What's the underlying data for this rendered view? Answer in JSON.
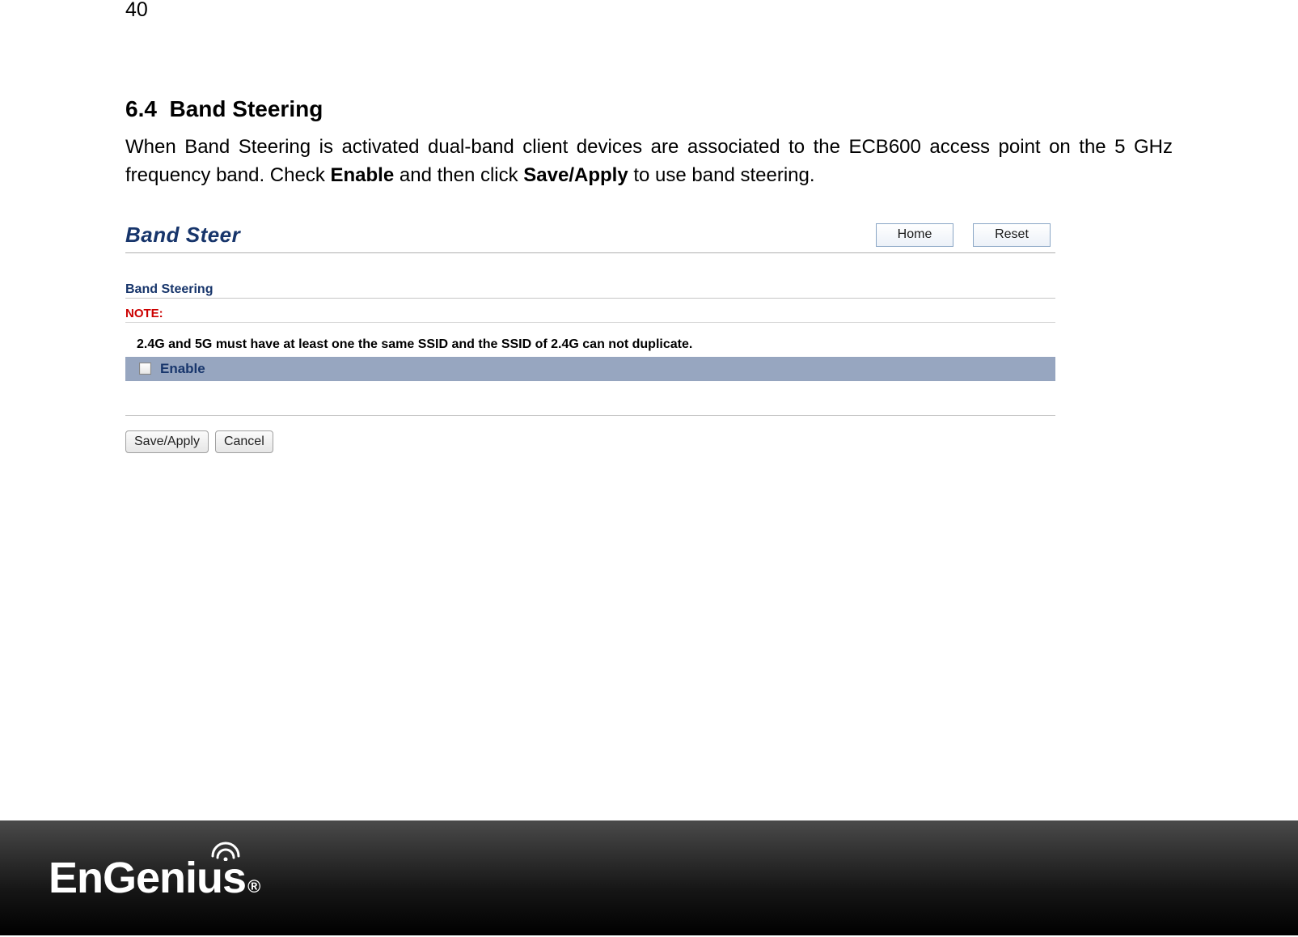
{
  "page_number": "40",
  "heading_number": "6.4",
  "heading_title": "Band Steering",
  "body_part1": "When Band Steering is activated dual-band client devices are associated to the ECB600 access point on the 5 GHz frequency band. Check ",
  "body_bold1": "Enable",
  "body_part2": " and then click ",
  "body_bold2": "Save/Apply",
  "body_part3": " to use band steering.",
  "admin": {
    "title": "Band Steer",
    "home": "Home",
    "reset": "Reset",
    "subheading": "Band Steering",
    "note_label": "NOTE:",
    "note_text": "2.4G and 5G must have at least one the same SSID and the SSID of 2.4G can not duplicate.",
    "enable_label": "Enable",
    "save": "Save/Apply",
    "cancel": "Cancel"
  },
  "brand": {
    "part1": "EnGen",
    "part2": "ius",
    "reg": "®"
  }
}
